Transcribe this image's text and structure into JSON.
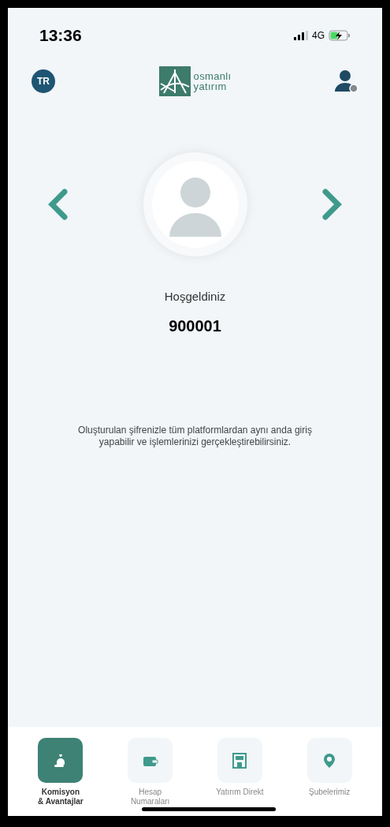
{
  "status_bar": {
    "time": "13:36",
    "network": "4G"
  },
  "header": {
    "language": "TR",
    "logo_lines": [
      "osmanlı",
      "yatırım"
    ]
  },
  "welcome": {
    "greeting": "Hoşgeldiniz",
    "account": "900001"
  },
  "info": "Oluşturulan şifrenizle tüm platformlardan aynı anda giriş yapabilir ve işlemlerinizi gerçekleştirebilirsiniz.",
  "tabs": [
    {
      "kind": "money",
      "label": [
        "Komisyon",
        "& Avantajlar"
      ],
      "selected": true
    },
    {
      "kind": "wallet",
      "label": [
        "Hesap",
        "Numaraları"
      ],
      "selected": false
    },
    {
      "kind": "store",
      "label": [
        "Yatırım Direkt"
      ],
      "selected": false
    },
    {
      "kind": "pin",
      "label": [
        "Şubelerimiz"
      ],
      "selected": false
    }
  ]
}
